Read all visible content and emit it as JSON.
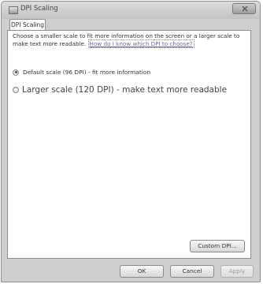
{
  "window": {
    "title": "DPI Scaling"
  },
  "tabs": [
    {
      "label": "DPI Scaling"
    }
  ],
  "main": {
    "description": "Choose a smaller scale to fit more information on the screen or a larger scale to make text more readable.",
    "help_link": "How do I know which DPI to choose?",
    "options": [
      {
        "label": "Default scale (96 DPI) - fit more information",
        "selected": true
      },
      {
        "label": "Larger scale (120 DPI) - make text more readable",
        "selected": false
      }
    ],
    "custom_button": "Custom DPI..."
  },
  "footer": {
    "ok": "OK",
    "cancel": "Cancel",
    "apply": "Apply"
  }
}
